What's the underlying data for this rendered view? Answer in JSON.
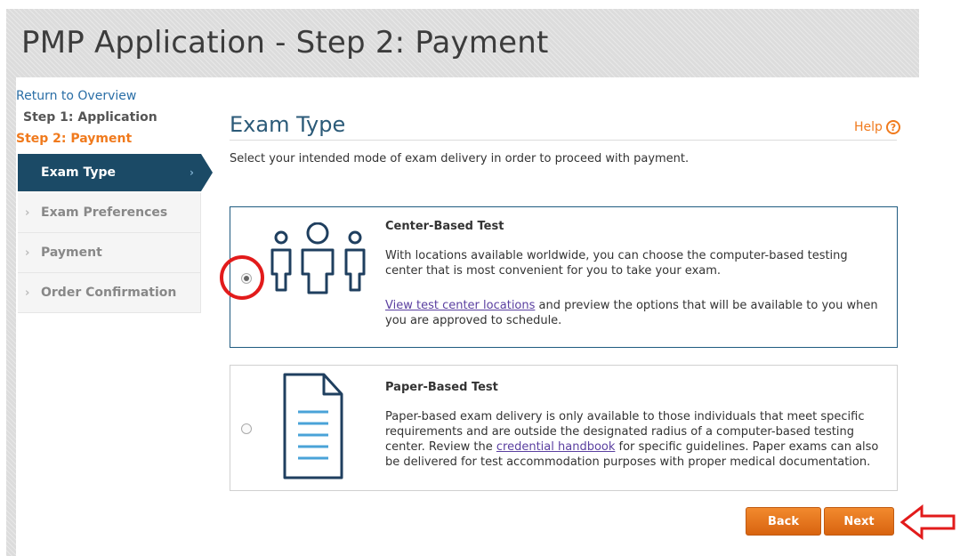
{
  "page": {
    "title": "PMP Application - Step 2: Payment"
  },
  "sidebar": {
    "return_link": "Return to Overview",
    "step1": "Step 1: Application",
    "step2": "Step 2: Payment",
    "items": [
      {
        "label": "Exam Type",
        "active": true
      },
      {
        "label": "Exam Preferences",
        "active": false
      },
      {
        "label": "Payment",
        "active": false
      },
      {
        "label": "Order Confirmation",
        "active": false
      }
    ],
    "chevron": "›"
  },
  "main": {
    "section_title": "Exam Type",
    "help_label": "Help",
    "help_icon": "?",
    "intro": "Select your intended mode of exam delivery in order to proceed with payment.",
    "options": [
      {
        "title": "Center-Based Test",
        "body": "With locations available worldwide, you can choose the computer-based testing center that is most convenient for you to take your exam.",
        "link": "View test center locations",
        "after_link": " and preview the options that will be available to you when you are approved to schedule.",
        "selected": true,
        "icon": "people-icon"
      },
      {
        "title": "Paper-Based Test",
        "body_before": "Paper-based exam delivery is only available to those individuals that meet specific requirements and are outside the designated radius of a computer-based testing center. Review the ",
        "link": "credential handbook",
        "body_after": " for specific guidelines. Paper exams can also be delivered for test accommodation purposes with proper medical documentation.",
        "selected": false,
        "icon": "document-icon"
      }
    ]
  },
  "buttons": {
    "back": "Back",
    "next": "Next"
  },
  "colors": {
    "accent": "#f07a1d",
    "nav_active": "#1b4a66",
    "annotation": "#e21b1b",
    "icon": "#1f3f5f"
  }
}
